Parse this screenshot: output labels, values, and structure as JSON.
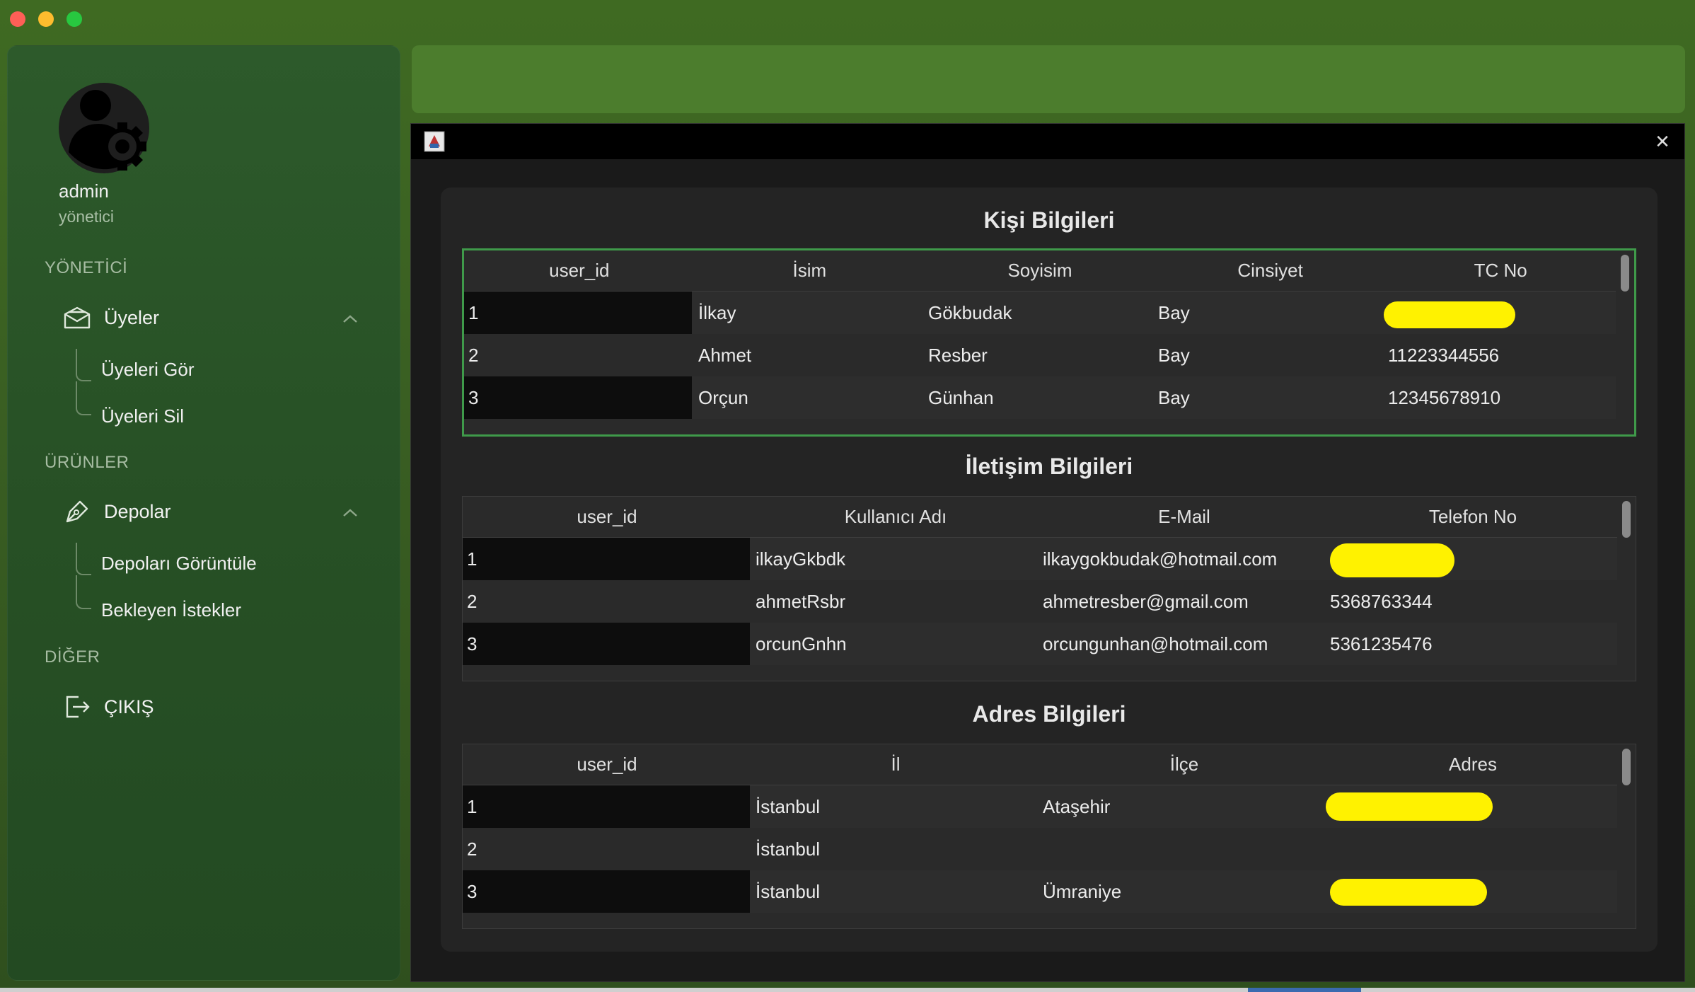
{
  "sidebar": {
    "user_name": "admin",
    "user_role": "yönetici",
    "sections": [
      {
        "label": "YÖNETİCİ"
      },
      {
        "label": "ÜRÜNLER"
      },
      {
        "label": "DİĞER"
      }
    ],
    "menu": {
      "uyeler": "Üyeler",
      "uyeleri_gor": "Üyeleri Gör",
      "uyeleri_sil": "Üyeleri Sil",
      "depolar": "Depolar",
      "depolari_goruntule": "Depoları Görüntüle",
      "bekleyen_istekler": "Bekleyen İstekler",
      "cikis": "ÇIKIŞ"
    }
  },
  "kisi": {
    "title": "Kişi Bilgileri",
    "headers": [
      "user_id",
      "İsim",
      "Soyisim",
      "Cinsiyet",
      "TC No"
    ],
    "rows": [
      [
        "1",
        "İlkay",
        "Gökbudak",
        "Bay",
        ""
      ],
      [
        "2",
        "Ahmet",
        "Resber",
        "Bay",
        "11223344556"
      ],
      [
        "3",
        "Orçun",
        "Günhan",
        "Bay",
        "12345678910"
      ]
    ]
  },
  "iletisim": {
    "title": "İletişim Bilgileri",
    "headers": [
      "user_id",
      "Kullanıcı Adı",
      "E-Mail",
      "Telefon No"
    ],
    "rows": [
      [
        "1",
        "ilkayGkbdk",
        "ilkaygokbudak@hotmail.com",
        ""
      ],
      [
        "2",
        "ahmetRsbr",
        "ahmetresber@gmail.com",
        "5368763344"
      ],
      [
        "3",
        "orcunGnhn",
        "orcungunhan@hotmail.com",
        "5361235476"
      ]
    ]
  },
  "adres": {
    "title": "Adres Bilgileri",
    "headers": [
      "user_id",
      "İl",
      "İlçe",
      "Adres"
    ],
    "rows": [
      [
        "1",
        "İstanbul",
        "Ataşehir",
        ""
      ],
      [
        "2",
        "İstanbul",
        "",
        ""
      ],
      [
        "3",
        "İstanbul",
        "Ümraniye",
        ""
      ]
    ]
  },
  "colors": {
    "accent_green": "#3f9a4a",
    "redaction": "#fff200"
  }
}
